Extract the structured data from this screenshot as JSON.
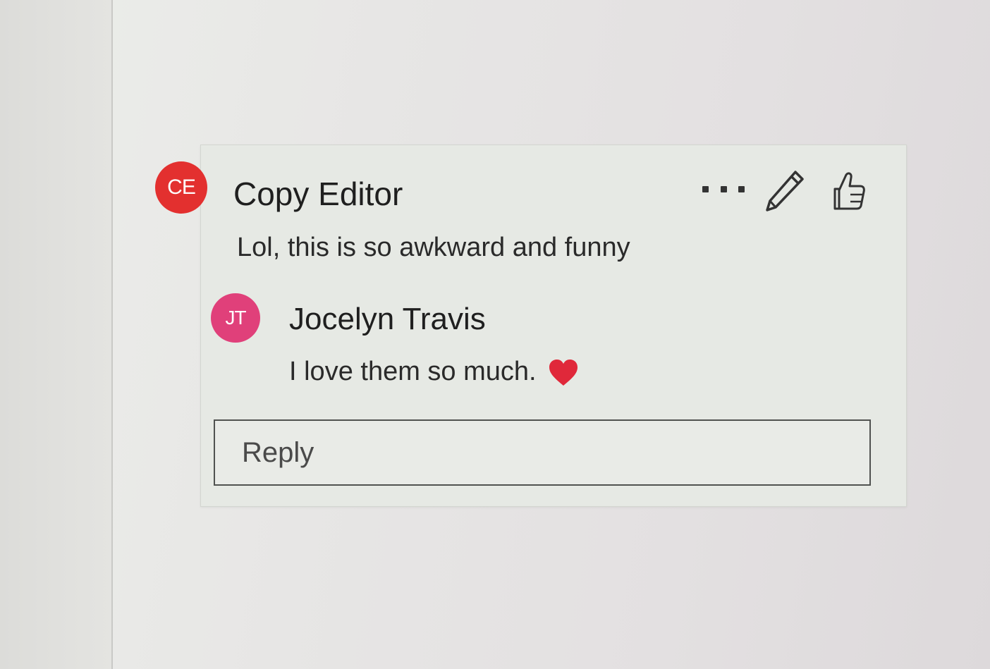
{
  "comment_thread": {
    "comments": [
      {
        "avatar_initials": "CE",
        "avatar_color": "#e3302f",
        "author": "Copy Editor",
        "text": "Lol, this is so awkward and funny"
      },
      {
        "avatar_initials": "JT",
        "avatar_color": "#e0407a",
        "author": "Jocelyn Travis",
        "text": "I love them so much.",
        "emoji_icon": "heart-icon"
      }
    ],
    "actions": {
      "more_icon": "more-options-icon",
      "edit_icon": "pencil-icon",
      "like_icon": "thumbs-up-icon"
    },
    "reply": {
      "placeholder": "Reply"
    }
  },
  "colors": {
    "heart": "#e0283a",
    "card_background": "#e6e9e4"
  }
}
